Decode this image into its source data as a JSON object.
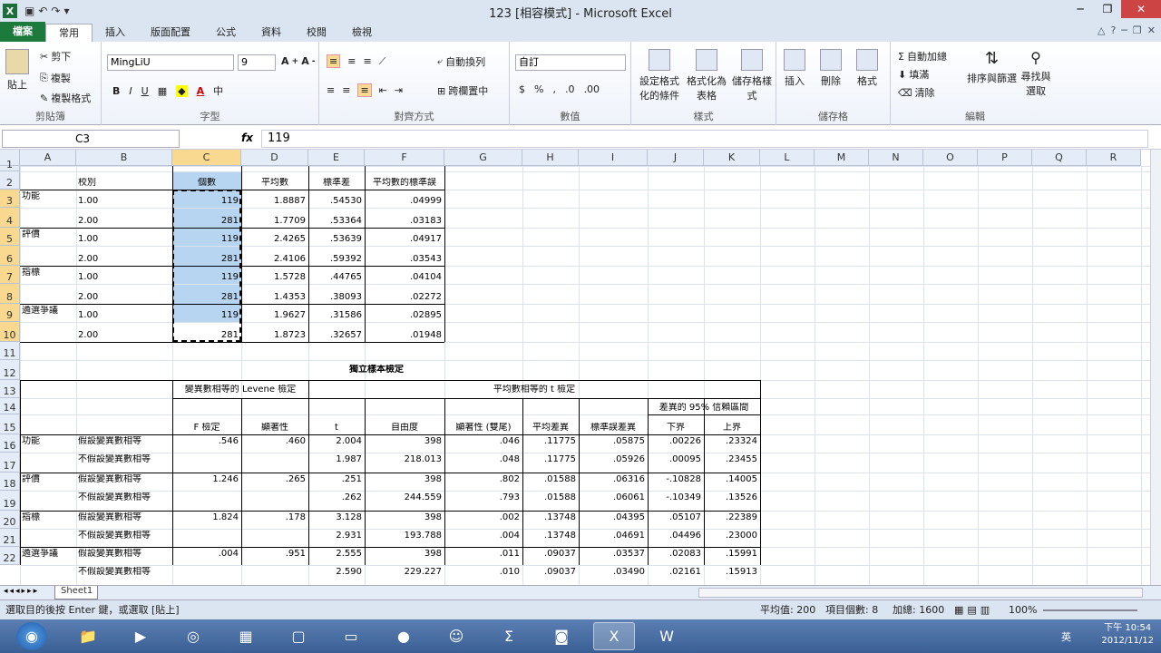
{
  "window": {
    "title": "123  [相容模式]  - Microsoft Excel",
    "logo": "X"
  },
  "tabs": [
    "檔案",
    "常用",
    "插入",
    "版面配置",
    "公式",
    "資料",
    "校閱",
    "檢視"
  ],
  "ribbon": {
    "clipboard": {
      "paste": "貼上",
      "cut": "剪下",
      "copy": "複製",
      "format_painter": "複製格式",
      "label": "剪貼簿"
    },
    "font": {
      "name": "MingLiU",
      "size": "9",
      "label": "字型"
    },
    "align": {
      "wrap": "自動換列",
      "merge": "跨欄置中",
      "label": "對齊方式"
    },
    "number": {
      "format": "自訂",
      "label": "數值"
    },
    "styles": {
      "cond": "設定格式化的條件",
      "table": "格式化為表格",
      "cell": "儲存格樣式",
      "label": "樣式"
    },
    "cells": {
      "insert": "插入",
      "delete": "刪除",
      "format": "格式",
      "label": "儲存格"
    },
    "editing": {
      "autosum": "自動加總",
      "fill": "填滿",
      "clear": "清除",
      "sort": "排序與篩選",
      "find": "尋找與選取",
      "label": "編輯"
    }
  },
  "formula_bar": {
    "name_box": "C3",
    "fx": "fx",
    "value": "119"
  },
  "columns": [
    "A",
    "B",
    "C",
    "D",
    "E",
    "F",
    "G",
    "H",
    "I",
    "J",
    "K",
    "L",
    "M",
    "N",
    "O",
    "P",
    "Q",
    "R"
  ],
  "rows": [
    "1",
    "2",
    "3",
    "4",
    "5",
    "6",
    "7",
    "8",
    "9",
    "10",
    "11",
    "12",
    "13",
    "14",
    "15",
    "16",
    "17",
    "18",
    "19",
    "20",
    "21",
    "22"
  ],
  "table1": {
    "headers": {
      "group": "校別",
      "n": "個數",
      "mean": "平均數",
      "sd": "標準差",
      "se": "平均數的標準誤"
    },
    "rows": [
      {
        "a": "功能",
        "b": "1.00",
        "c": "119",
        "d": "1.8887",
        "e": ".54530",
        "f": ".04999"
      },
      {
        "a": "",
        "b": "2.00",
        "c": "281",
        "d": "1.7709",
        "e": ".53364",
        "f": ".03183"
      },
      {
        "a": "評價",
        "b": "1.00",
        "c": "119",
        "d": "2.4265",
        "e": ".53639",
        "f": ".04917"
      },
      {
        "a": "",
        "b": "2.00",
        "c": "281",
        "d": "2.4106",
        "e": ".59392",
        "f": ".03543"
      },
      {
        "a": "指標",
        "b": "1.00",
        "c": "119",
        "d": "1.5728",
        "e": ".44765",
        "f": ".04104"
      },
      {
        "a": "",
        "b": "2.00",
        "c": "281",
        "d": "1.4353",
        "e": ".38093",
        "f": ".02272"
      },
      {
        "a": "遴選爭議",
        "b": "1.00",
        "c": "119",
        "d": "1.9627",
        "e": ".31586",
        "f": ".02895"
      },
      {
        "a": "",
        "b": "2.00",
        "c": "281",
        "d": "1.8723",
        "e": ".32657",
        "f": ".01948"
      }
    ]
  },
  "table2": {
    "title": "獨立樣本檢定",
    "levene": "變異數相等的 Levene 檢定",
    "ttest": "平均數相等的 t 檢定",
    "ci": "差異的 95% 信賴區間",
    "headers": [
      "F 檢定",
      "顯著性",
      "t",
      "自由度",
      "顯著性 (雙尾)",
      "平均差異",
      "標準誤差異",
      "下界",
      "上界"
    ],
    "rows": [
      {
        "a": "功能",
        "b": "假設變異數相等",
        "v": [
          ".546",
          ".460",
          "2.004",
          "398",
          ".046",
          ".11775",
          ".05875",
          ".00226",
          ".23324"
        ]
      },
      {
        "a": "",
        "b": "不假設變異數相等",
        "v": [
          "",
          "",
          "1.987",
          "218.013",
          ".048",
          ".11775",
          ".05926",
          ".00095",
          ".23455"
        ]
      },
      {
        "a": "評價",
        "b": "假設變異數相等",
        "v": [
          "1.246",
          ".265",
          ".251",
          "398",
          ".802",
          ".01588",
          ".06316",
          "-.10828",
          ".14005"
        ]
      },
      {
        "a": "",
        "b": "不假設變異數相等",
        "v": [
          "",
          "",
          ".262",
          "244.559",
          ".793",
          ".01588",
          ".06061",
          "-.10349",
          ".13526"
        ]
      },
      {
        "a": "指標",
        "b": "假設變異數相等",
        "v": [
          "1.824",
          ".178",
          "3.128",
          "398",
          ".002",
          ".13748",
          ".04395",
          ".05107",
          ".22389"
        ]
      },
      {
        "a": "",
        "b": "不假設變異數相等",
        "v": [
          "",
          "",
          "2.931",
          "193.788",
          ".004",
          ".13748",
          ".04691",
          ".04496",
          ".23000"
        ]
      },
      {
        "a": "遴選爭議",
        "b": "假設變異數相等",
        "v": [
          ".004",
          ".951",
          "2.555",
          "398",
          ".011",
          ".09037",
          ".03537",
          ".02083",
          ".15991"
        ]
      },
      {
        "a": "",
        "b": "不假設變異數相等",
        "v": [
          "",
          "",
          "2.590",
          "229.227",
          ".010",
          ".09037",
          ".03490",
          ".02161",
          ".15913"
        ]
      }
    ]
  },
  "sheet_tab": "Sheet1",
  "status": {
    "left": "選取目的後按 Enter 鍵，或選取 [貼上]",
    "avg": "平均值: 200",
    "count": "項目個數: 8",
    "sum": "加總: 1600",
    "zoom": "100%"
  },
  "clock": {
    "time": "下午 10:54",
    "date": "2012/11/12"
  },
  "taskbar_lang": "英"
}
